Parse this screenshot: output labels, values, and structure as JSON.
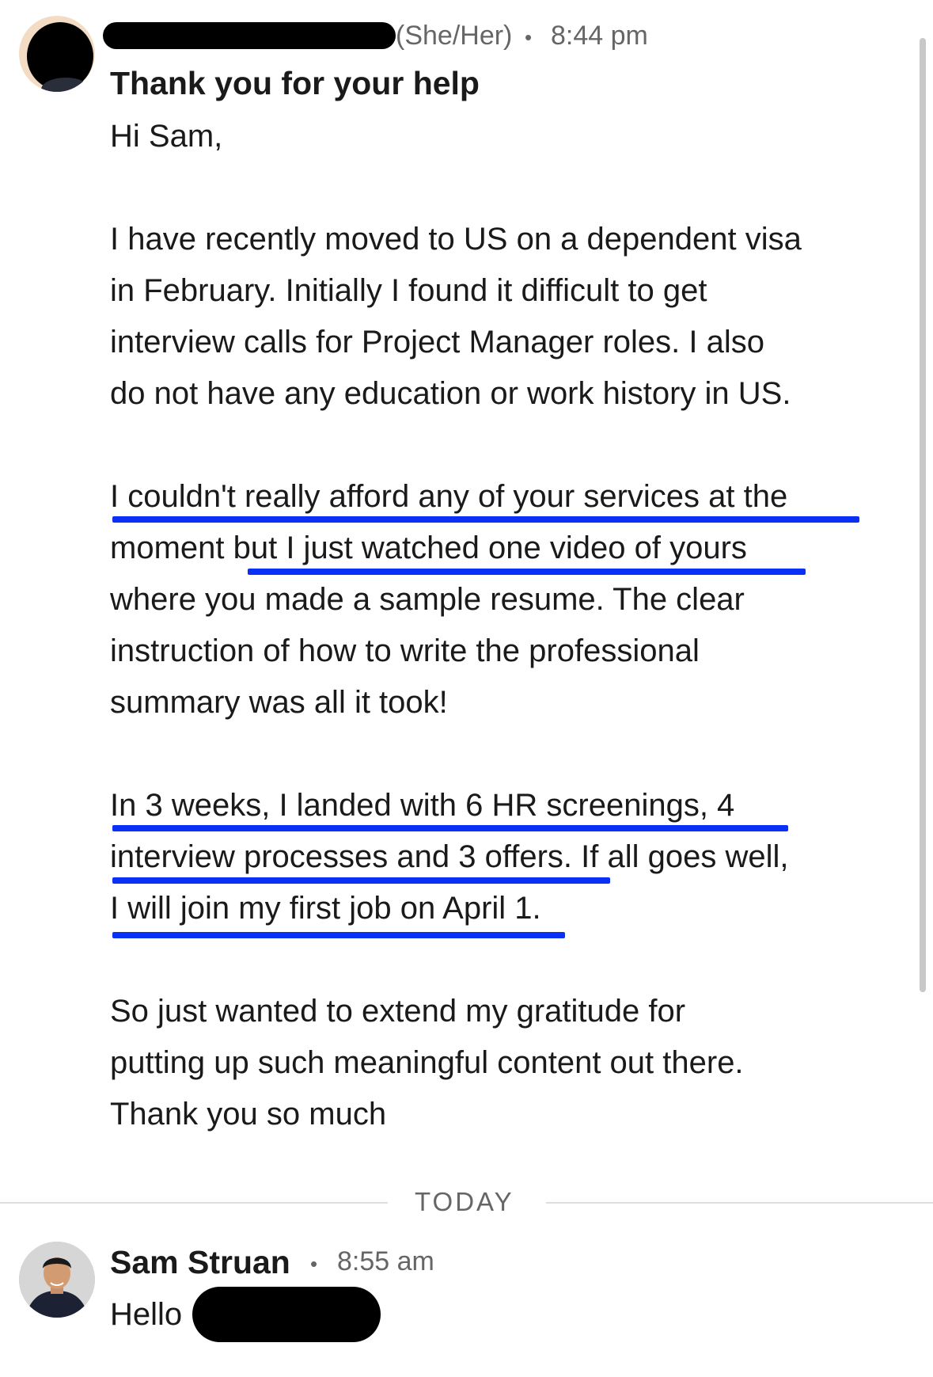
{
  "message1": {
    "pronouns": "(She/Her)",
    "time": "8:44 pm",
    "subject": "Thank you for your help",
    "lines": [
      "Hi Sam,",
      "I have recently moved to US on a dependent visa",
      "in February. Initially I found it difficult to get",
      "interview calls for Project Manager roles. I also",
      "do not have any education or work history in US.",
      "I couldn't really afford any of your services at the",
      "moment but I just watched one video of yours",
      "where you made a sample resume. The clear",
      "instruction of how to write the professional",
      "summary was all it took!",
      "In 3 weeks, I landed with 6 HR screenings, 4",
      "interview processes and 3 offers. If all goes well,",
      "I will join my first job on April 1.",
      "So just wanted to extend my gratitude for",
      "putting up such meaningful content out there.",
      "Thank you so much"
    ]
  },
  "separator": {
    "label": "TODAY"
  },
  "message2": {
    "sender": "Sam Struan",
    "time": "8:55 am",
    "text": "Hello"
  },
  "colors": {
    "underline": "#0a2ff5",
    "meta": "#666666"
  }
}
